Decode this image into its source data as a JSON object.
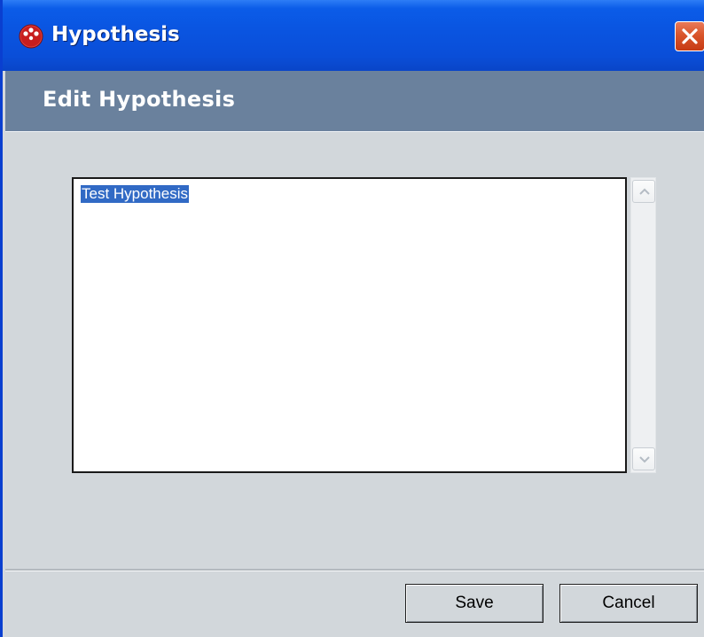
{
  "window": {
    "title": "Hypothesis",
    "icon": "app-logo-icon",
    "close_icon": "close-icon"
  },
  "header": {
    "title": "Edit Hypothesis"
  },
  "editor": {
    "value": "Test Hypothesis",
    "selected": true,
    "scroll_up_icon": "chevron-up-icon",
    "scroll_down_icon": "chevron-down-icon"
  },
  "footer": {
    "save_label": "Save",
    "cancel_label": "Cancel"
  },
  "colors": {
    "titlebar": "#0a54e0",
    "header_band": "#6a819d",
    "body": "#d2d7db",
    "selection": "#316ac5",
    "close_button": "#d9552b"
  }
}
